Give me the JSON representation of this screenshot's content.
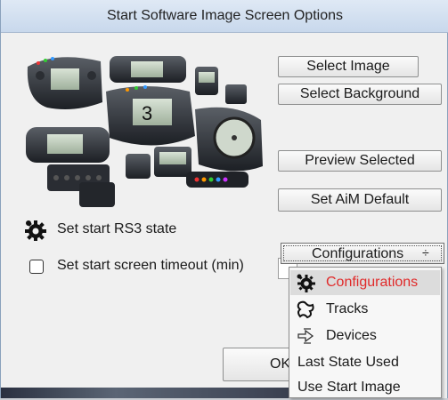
{
  "dialog": {
    "title": "Start Software Image Screen Options"
  },
  "buttons": {
    "select_image": "Select Image",
    "select_background": "Select Background",
    "preview_selected": "Preview Selected",
    "set_aim_default": "Set AiM Default",
    "ok": "OK"
  },
  "options": {
    "rs3_state_label": "Set start RS3 state",
    "timeout_label": "Set start screen timeout (min)",
    "timeout_checked": false,
    "timeout_value": ""
  },
  "dropdown": {
    "selected": "Configurations",
    "arrow": "÷",
    "items": [
      {
        "label": "Configurations",
        "icon": "configurations-gear-icon",
        "selected": true
      },
      {
        "label": "Tracks",
        "icon": "track-outline-icon",
        "selected": false
      },
      {
        "label": "Devices",
        "icon": "devices-arrows-icon",
        "selected": false
      },
      {
        "label": "Last State Used",
        "icon": "",
        "selected": false
      },
      {
        "label": "Use Start Image",
        "icon": "",
        "selected": false
      }
    ]
  },
  "colors": {
    "selected_text": "#e02a2a",
    "title_gradient_top": "#dfe9f5",
    "dialog_bg": "#f0f0f0"
  }
}
